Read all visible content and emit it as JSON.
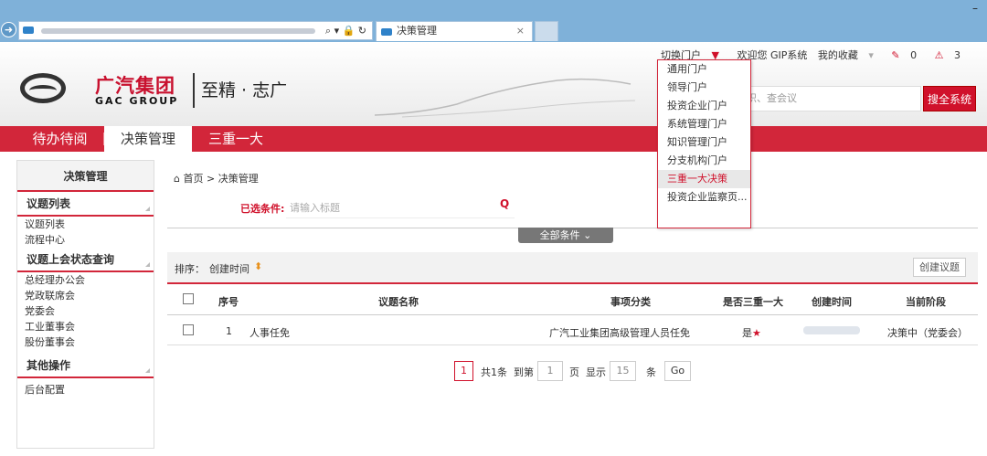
{
  "browser": {
    "tab_title": "决策管理",
    "tab_close": "×",
    "back": "➜",
    "addr_icons": "⌕ ▾ 🔒 ↻",
    "minimize": "–"
  },
  "header": {
    "logo_cn": "广汽集团",
    "logo_en": "GAC GROUP",
    "slogan": "至精 · 志广",
    "switch_portal": "切换门户",
    "welcome": "欢迎您 GIP系统",
    "favorites": "我的收藏",
    "edit_count": "0",
    "alert_count": "3",
    "search_placeholder": "识、查会议",
    "search_button": "搜全系统"
  },
  "nav": {
    "items": [
      {
        "label": "待办待阅"
      },
      {
        "label": "决策管理"
      },
      {
        "label": "三重一大"
      }
    ]
  },
  "sidebar": {
    "title": "决策管理",
    "sections": [
      {
        "title": "议题列表",
        "items": [
          "议题列表",
          "流程中心"
        ]
      },
      {
        "title": "议题上会状态查询",
        "items": [
          "总经理办公会",
          "党政联席会",
          "党委会",
          "工业董事会",
          "股份董事会"
        ]
      },
      {
        "title": "其他操作",
        "items": [
          "后台配置"
        ]
      }
    ]
  },
  "breadcrumb": {
    "home": "首页",
    "sep": ">",
    "current": "决策管理"
  },
  "filter": {
    "label": "已选条件:",
    "placeholder": "请输入标题",
    "all_conditions": "全部条件"
  },
  "sort": {
    "label": "排序：",
    "field": "创建时间"
  },
  "create_button": "创建议题",
  "table": {
    "headers": [
      "序号",
      "议题名称",
      "事项分类",
      "是否三重一大",
      "创建时间",
      "当前阶段"
    ],
    "rows": [
      {
        "no": "1",
        "name": "人事任免",
        "category": "广汽工业集团高级管理人员任免",
        "is_major": "是",
        "star": "★",
        "stage": "决策中（党委会）"
      }
    ]
  },
  "pager": {
    "current": "1",
    "total": "共1条",
    "goto": "到第",
    "goto_value": "1",
    "page_unit": "页",
    "show": "显示",
    "size": "15",
    "size_unit": "条",
    "go": "Go"
  },
  "dropdown": {
    "items": [
      "通用门户",
      "领导门户",
      "投资企业门户",
      "系统管理门户",
      "知识管理门户",
      "分支机构门户",
      "三重一大决策",
      "投资企业监察页..."
    ],
    "active_index": 6
  },
  "colors": {
    "brand_red": "#d2263a",
    "accent_orange": "#e8901a",
    "browser_blue": "#7fb1d9"
  }
}
